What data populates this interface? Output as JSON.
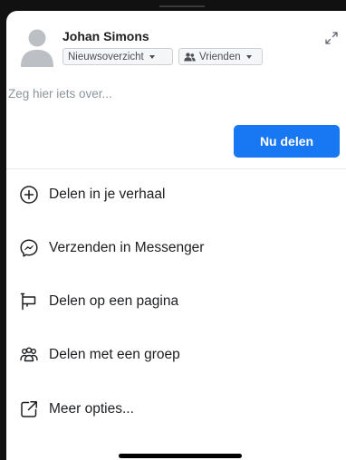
{
  "post": {
    "user_name": "Johan Simons",
    "audience_feed": "Nieuwsoverzicht",
    "audience_privacy": "Vrienden",
    "compose_placeholder": "Zeg hier iets over...",
    "share_button": "Nu delen"
  },
  "options": [
    {
      "label": "Delen in je verhaal",
      "icon": "plus-circle-icon"
    },
    {
      "label": "Verzenden in Messenger",
      "icon": "messenger-icon"
    },
    {
      "label": "Delen op een pagina",
      "icon": "flag-icon"
    },
    {
      "label": "Delen met een groep",
      "icon": "group-icon"
    },
    {
      "label": "Meer opties...",
      "icon": "external-link-icon"
    }
  ],
  "colors": {
    "accent": "#1877f2",
    "text": "#1c1e21",
    "placeholder": "#8d949e"
  }
}
